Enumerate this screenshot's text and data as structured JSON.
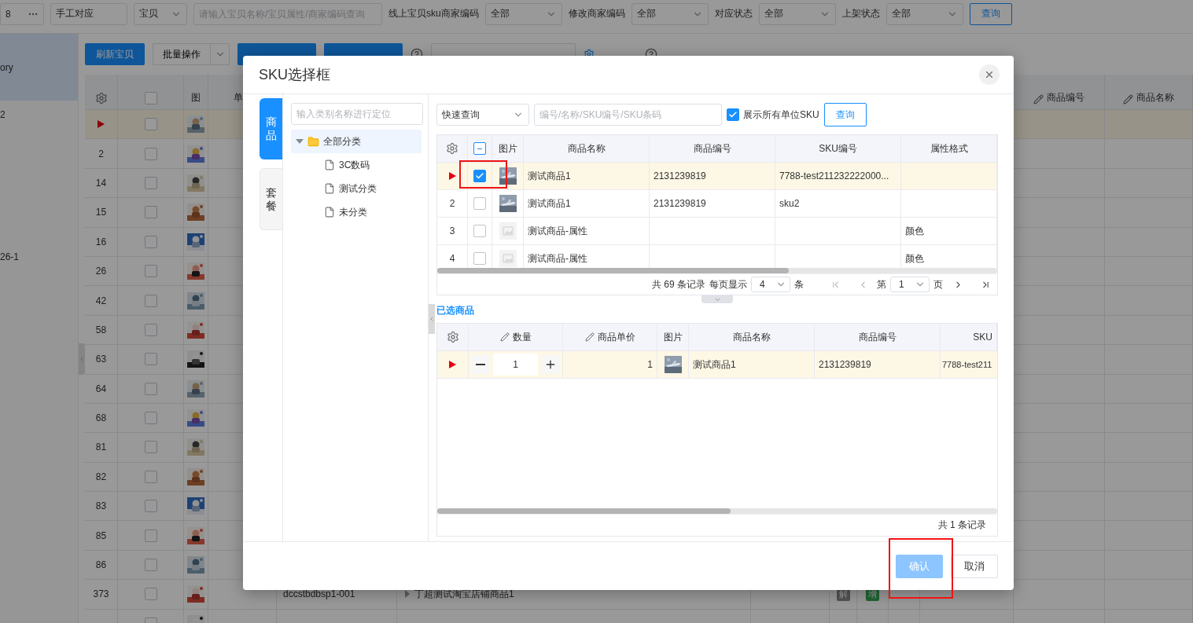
{
  "filter_bar": {
    "shop_value": "8",
    "mode_value": "手工对应",
    "type_select": "宝贝",
    "search_placeholder": "请输入宝贝名称/宝贝属性/商家编码查询",
    "filters": [
      {
        "label": "线上宝贝sku商家编码",
        "value": "全部"
      },
      {
        "label": "修改商家编码",
        "value": "全部"
      },
      {
        "label": "对应状态",
        "value": "全部"
      },
      {
        "label": "上架状态",
        "value": "全部"
      }
    ],
    "query_button": "查询"
  },
  "toolbar": {
    "buttons": [
      {
        "kind": "primary",
        "label": "刷新宝贝"
      },
      {
        "kind": "split",
        "label": "批量操作"
      },
      {
        "kind": "primary"
      },
      {
        "kind": "primary"
      },
      {
        "kind": "help"
      },
      {
        "kind": "outline"
      },
      {
        "kind": "link"
      },
      {
        "kind": "help"
      }
    ]
  },
  "sidebar": {
    "items": [
      {
        "label": "ory",
        "selected": true
      },
      {
        "label": "2",
        "selected": false
      },
      {
        "label": "26-1",
        "selected": false
      }
    ]
  },
  "product_table": {
    "header_checked": false,
    "columns": [
      {
        "label": "图",
        "editable": false
      },
      {
        "label": "单",
        "editable": false
      },
      {
        "label": "商品编号",
        "editable": true
      },
      {
        "label": "商品名称",
        "editable": true
      }
    ],
    "rows": [
      {
        "current": true,
        "checked": false
      },
      {
        "current": false,
        "no": "2",
        "checked": false
      },
      {
        "current": false,
        "no": "14",
        "checked": false
      },
      {
        "current": false,
        "no": "15",
        "checked": false
      },
      {
        "current": false,
        "no": "16",
        "checked": false
      },
      {
        "current": false,
        "no": "26",
        "checked": false
      },
      {
        "current": false,
        "no": "42",
        "checked": false
      },
      {
        "current": false,
        "no": "58",
        "checked": false
      },
      {
        "current": false,
        "no": "63",
        "checked": false
      },
      {
        "current": false,
        "no": "64",
        "checked": false
      },
      {
        "current": false,
        "no": "68",
        "checked": false
      },
      {
        "current": false,
        "no": "81",
        "checked": false
      },
      {
        "current": false,
        "no": "82",
        "checked": false
      },
      {
        "current": false,
        "no": "83",
        "checked": false
      },
      {
        "current": false,
        "no": "85",
        "checked": false
      },
      {
        "current": false,
        "no": "86",
        "checked": false
      },
      {
        "current": false,
        "no": "373",
        "checked": false,
        "code": "dccstbdbsp1-001",
        "name": "丁超测试淘宝店铺商品1",
        "tags": [
          {
            "label": "解",
            "kind": "muted"
          },
          {
            "label": "增",
            "kind": "success"
          }
        ]
      },
      {
        "checked": false
      }
    ]
  },
  "dialog": {
    "title": "SKU选择框",
    "side_tabs": [
      {
        "label": "商品",
        "selected": true
      },
      {
        "label": "套餐",
        "selected": false
      }
    ],
    "category_search": {
      "placeholder": "输入类别名称进行定位"
    },
    "category_tree": [
      {
        "label": "全部分类",
        "expanded": true,
        "selected": true,
        "children": [
          {
            "label": "3C数码",
            "selected": false
          },
          {
            "label": "测试分类",
            "selected": false
          },
          {
            "label": "未分类",
            "selected": false
          }
        ]
      }
    ],
    "query": {
      "mode": "快速查询",
      "placeholder": "编号/名称/SKU编号/SKU条码",
      "show_all_units": {
        "label": "展示所有单位SKU",
        "checked": true
      },
      "button": "查询"
    },
    "sku_table": {
      "header_indeterminate": true,
      "columns": [
        "图片",
        "商品名称",
        "商品编号",
        "SKU编号",
        "属性格式"
      ],
      "rows": [
        {
          "current": true,
          "checked": true,
          "has_image": true,
          "name": "测试商品1",
          "code": "2131239819",
          "sku": "7788-test211232222000..."
        },
        {
          "current": false,
          "no": "2",
          "checked": false,
          "has_image": true,
          "name": "测试商品1",
          "code": "2131239819",
          "sku": "sku2"
        },
        {
          "current": false,
          "no": "3",
          "checked": false,
          "has_image": false,
          "name": "测试商品-属性",
          "attribute": "颜色"
        },
        {
          "current": false,
          "no": "4",
          "checked": false,
          "has_image": false,
          "name": "测试商品-属性",
          "attribute": "颜色"
        }
      ],
      "pager": {
        "total": "共 69 条记录",
        "per_page_label": "每页显示",
        "per_page": "4",
        "per_page_unit": "条",
        "page_label": "第",
        "page": "1",
        "page_unit": "页"
      }
    },
    "selected_section": {
      "title": "已选商品",
      "columns": [
        {
          "label": "数量",
          "editable": true
        },
        {
          "label": "商品单价",
          "editable": true
        },
        {
          "label": "图片",
          "editable": false
        },
        {
          "label": "商品名称",
          "editable": false
        },
        {
          "label": "商品编号",
          "editable": false
        },
        {
          "label": "SKU",
          "editable": false
        }
      ],
      "rows": [
        {
          "current": true,
          "quantity": "1",
          "price": "1",
          "has_image": true,
          "name": "测试商品1",
          "code": "2131239819",
          "sku": "7788-test211"
        }
      ],
      "total": "共 1 条记录"
    },
    "buttons": [
      {
        "kind": "primary",
        "label": "确认",
        "disabled": true
      },
      {
        "kind": "default",
        "label": "取消",
        "disabled": false
      }
    ]
  }
}
